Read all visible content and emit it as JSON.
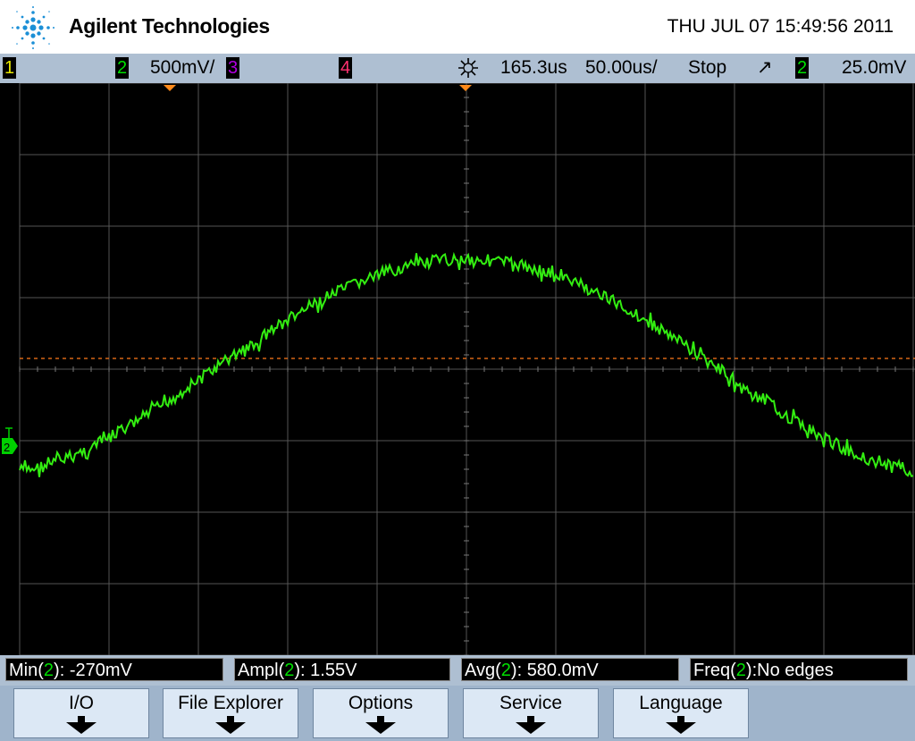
{
  "header": {
    "brand": "Agilent Technologies",
    "datetime": "THU JUL 07 15:49:56 2011"
  },
  "status": {
    "channels": [
      "1",
      "2",
      "3",
      "4"
    ],
    "scale": "500mV/",
    "delay": "165.3us",
    "timebase": "50.00us/",
    "run_state": "Stop",
    "trigger_slope": "↗",
    "trigger_channel": "2",
    "trigger_level": "25.0mV"
  },
  "display": {
    "ground_marker": "2",
    "trace_color": "#33ee11",
    "trigger_line_color": "#ff7a1a"
  },
  "measurements": [
    {
      "name": "Min",
      "channel": "2",
      "sep": "): ",
      "value": "-270mV"
    },
    {
      "name": "Ampl",
      "channel": "2",
      "sep": "): ",
      "value": "1.55V"
    },
    {
      "name": "Avg",
      "channel": "2",
      "sep": "): ",
      "value": "580.0mV"
    },
    {
      "name": "Freq",
      "channel": "2",
      "sep": "):",
      "value": "No edges"
    }
  ],
  "softkeys": [
    "I/O",
    "File Explorer",
    "Options",
    "Service",
    "Language"
  ],
  "colors": {
    "status_bar": "#aebfd2",
    "softkey_face": "#dce8f5",
    "screen_bg": "#000000",
    "grid": "#555555"
  }
}
